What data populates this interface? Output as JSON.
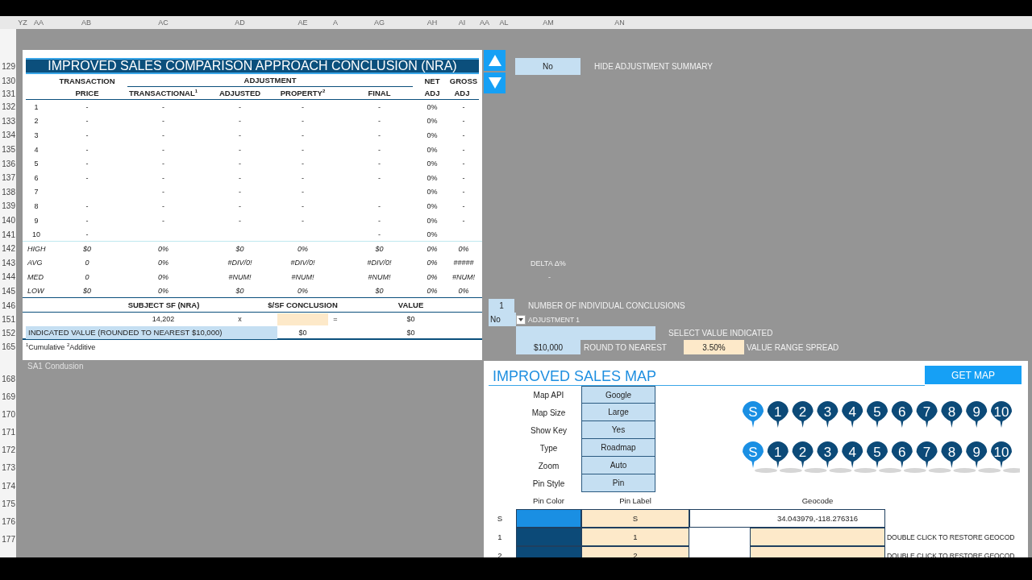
{
  "columns": [
    "YZ",
    "AA",
    "AB",
    "AC",
    "AD",
    "AE",
    "A",
    "AG",
    "AH",
    "AI",
    "AA",
    "AL",
    "AM",
    "AN"
  ],
  "row_numbers": [
    "129",
    "130",
    "131",
    "132",
    "133",
    "134",
    "135",
    "136",
    "137",
    "138",
    "139",
    "140",
    "141",
    "142",
    "143",
    "144",
    "145",
    "146",
    "151",
    "152",
    "165",
    "168",
    "169",
    "170",
    "171",
    "172",
    "173",
    "174",
    "175",
    "176",
    "177"
  ],
  "conclusion_table": {
    "title": "IMPROVED SALES COMPARISON APPROACH CONCLUSION (NRA)",
    "header_top": {
      "price": "TRANSACTION",
      "adjustment": "ADJUSTMENT",
      "net_adj": "NET",
      "gross_adj": "GROSS"
    },
    "header_bottom": {
      "price": "PRICE",
      "transactional": "TRANSACTIONAL$^{1}$",
      "adjusted": "ADJUSTED",
      "property": "PROPERTY$^{2}$",
      "final": "FINAL",
      "net_adj": "ADJ",
      "gross_adj": "ADJ"
    },
    "rows": [
      {
        "label": "1",
        "price": "-",
        "transactional": "-",
        "adjusted": "-",
        "property": "-",
        "final": "-",
        "net_adj": "0%",
        "gross_adj": "-"
      },
      {
        "label": "2",
        "price": "-",
        "transactional": "-",
        "adjusted": "-",
        "property": "-",
        "final": "-",
        "net_adj": "0%",
        "gross_adj": "-"
      },
      {
        "label": "3",
        "price": "-",
        "transactional": "-",
        "adjusted": "-",
        "property": "-",
        "final": "-",
        "net_adj": "0%",
        "gross_adj": "-"
      },
      {
        "label": "4",
        "price": "-",
        "transactional": "-",
        "adjusted": "-",
        "property": "-",
        "final": "-",
        "net_adj": "0%",
        "gross_adj": "-"
      },
      {
        "label": "5",
        "price": "-",
        "transactional": "-",
        "adjusted": "-",
        "property": "-",
        "final": "-",
        "net_adj": "0%",
        "gross_adj": "-"
      },
      {
        "label": "6",
        "price": "-",
        "transactional": "-",
        "adjusted": "-",
        "property": "-",
        "final": "-",
        "net_adj": "0%",
        "gross_adj": "-"
      },
      {
        "label": "7",
        "transactional": "-",
        "adjusted": "-",
        "property": "-",
        "net_adj": "0%",
        "gross_adj": "-"
      },
      {
        "label": "8",
        "price": "-",
        "transactional": "-",
        "adjusted": "-",
        "property": "-",
        "final": "-",
        "net_adj": "0%",
        "gross_adj": "-"
      },
      {
        "label": "9",
        "price": "-",
        "transactional": "-",
        "adjusted": "-",
        "property": "-",
        "final": "-",
        "net_adj": "0%",
        "gross_adj": "-"
      },
      {
        "label": "10",
        "price": "-",
        "final": "-",
        "net_adj": "0%"
      }
    ],
    "stats": [
      {
        "label": "HIGH",
        "price": "$0",
        "transactional": "0%",
        "adjusted": "$0",
        "property": "0%",
        "final": "$0",
        "net_adj": "0%",
        "gross_adj": "0%"
      },
      {
        "label": "AVG",
        "price": "0",
        "transactional": "0%",
        "adjusted": "#DIV/0!",
        "property": "#DIV/0!",
        "final": "#DIV/0!",
        "net_adj": "0%",
        "gross_adj": "#####"
      },
      {
        "label": "MED",
        "price": "0",
        "transactional": "0%",
        "adjusted": "#NUM!",
        "property": "#NUM!",
        "final": "#NUM!",
        "net_adj": "0%",
        "gross_adj": "#NUM!"
      },
      {
        "label": "LOW",
        "price": "$0",
        "transactional": "0%",
        "adjusted": "$0",
        "property": "0%",
        "final": "$0",
        "net_adj": "0%",
        "gross_adj": "0%"
      }
    ],
    "summary": {
      "subject_sf_label": "SUBJECT SF (NRA)",
      "conclusion_label": "$/SF CONCLUSION",
      "value_label": "VALUE",
      "subject_sf": "14,202",
      "times": "x",
      "equals": "=",
      "value": "$0",
      "indicated_label": "INDICATED VALUE (ROUNDED TO NEAREST $10,000)",
      "indicated_psf": "$0",
      "indicated_value": "$0"
    },
    "footnote": "$^{1}$Cumulative $^{2}$Additive"
  },
  "sheet_label": "SA1 Condusion",
  "adjustment_summary": {
    "value": "No",
    "label": "HIDE ADJUSTMENT SUMMARY"
  },
  "delta": {
    "label": "DELTA Δ%",
    "value": "-"
  },
  "conclusions": {
    "value": "1",
    "label": "NUMBER OF INDIVIDUAL CONCLUSIONS"
  },
  "adjustment_select": {
    "value": "No",
    "label": "ADJUSTMENT 1"
  },
  "value_indicated": {
    "label": "SELECT VALUE INDICATED"
  },
  "rounding": {
    "value": "$10,000",
    "label": "ROUND TO NEAREST",
    "spread": "3.50%",
    "spread_label": "VALUE RANGE SPREAD"
  },
  "map": {
    "title": "IMPROVED SALES MAP",
    "button": "GET MAP",
    "settings": [
      {
        "label": "Map API",
        "value": "Google"
      },
      {
        "label": "Map Size",
        "value": "Large"
      },
      {
        "label": "Show Key",
        "value": "Yes"
      },
      {
        "label": "Type",
        "value": "Roadmap"
      },
      {
        "label": "Zoom",
        "value": "Auto"
      },
      {
        "label": "Pin Style",
        "value": "Pin"
      }
    ],
    "pin_rows": [
      {
        "kind": "plain",
        "pins": [
          {
            "label": "S",
            "color": "#1a8fe3"
          },
          {
            "label": "1",
            "color": "#0c4a78"
          },
          {
            "label": "2",
            "color": "#0c4a78"
          },
          {
            "label": "3",
            "color": "#0c4a78"
          },
          {
            "label": "4",
            "color": "#0c4a78"
          },
          {
            "label": "5",
            "color": "#0c4a78"
          },
          {
            "label": "6",
            "color": "#0c4a78"
          },
          {
            "label": "7",
            "color": "#0c4a78"
          },
          {
            "label": "8",
            "color": "#0c4a78"
          },
          {
            "label": "9",
            "color": "#0c4a78"
          },
          {
            "label": "10",
            "color": "#0c4a78"
          }
        ]
      },
      {
        "kind": "shadow",
        "pins": [
          {
            "label": "S",
            "color": "#1a8fe3"
          },
          {
            "label": "1",
            "color": "#0c4a78"
          },
          {
            "label": "2",
            "color": "#0c4a78"
          },
          {
            "label": "3",
            "color": "#0c4a78"
          },
          {
            "label": "4",
            "color": "#0c4a78"
          },
          {
            "label": "5",
            "color": "#0c4a78"
          },
          {
            "label": "6",
            "color": "#0c4a78"
          },
          {
            "label": "7",
            "color": "#0c4a78"
          },
          {
            "label": "8",
            "color": "#0c4a78"
          },
          {
            "label": "9",
            "color": "#0c4a78"
          },
          {
            "label": "10",
            "color": "#0c4a78"
          }
        ]
      }
    ],
    "headers": {
      "pin_color": "Pin Color",
      "pin_label": "Pin Label",
      "geocode": "Geocode"
    },
    "rows": [
      {
        "id": "S",
        "color": "#1a8fe3",
        "pin_label": "S",
        "geocode": "34.043979,-118.276316"
      },
      {
        "id": "1",
        "color": "#0c4a78",
        "pin_label": "1",
        "note": "DOUBLE CLICK TO RESTORE GEOCOD"
      },
      {
        "id": "2",
        "color": "#0c4a78",
        "pin_label": "2",
        "note": "DOUBLE CLICK TO RESTORE GEOCOD"
      }
    ]
  }
}
